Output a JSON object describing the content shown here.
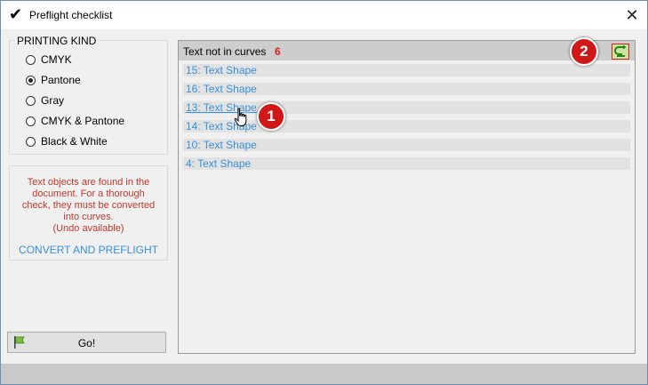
{
  "window": {
    "title": "Preflight checklist",
    "title_icon": "checkmark-icon",
    "close_glyph": "✕"
  },
  "printing_kind": {
    "label": "PRINTING KIND",
    "options": [
      {
        "label": "CMYK",
        "selected": false
      },
      {
        "label": "Pantone",
        "selected": true
      },
      {
        "label": "Gray",
        "selected": false
      },
      {
        "label": "CMYK & Pantone",
        "selected": false
      },
      {
        "label": "Black & White",
        "selected": false
      }
    ]
  },
  "info": {
    "lines": [
      "Text objects are found in the",
      "document. For a thorough",
      "check, they must be converted",
      "into curves.",
      "(Undo available)"
    ],
    "convert_link": "CONVERT AND PREFLIGHT",
    "text_color": "#c0392b",
    "link_color": "#3a8fd8"
  },
  "go_button": {
    "label": "Go!",
    "icon": "green-flag-icon"
  },
  "results": {
    "title": "Text not in curves",
    "count": "6",
    "refresh_icon": "refresh-arrow-icon",
    "items": [
      "15: Text Shape",
      "16: Text Shape",
      "13: Text Shape",
      "14: Text Shape",
      "10: Text Shape",
      "4: Text Shape"
    ]
  },
  "annotations": {
    "badge_1": "1",
    "badge_2": "2",
    "badge_color": "#d01818"
  }
}
